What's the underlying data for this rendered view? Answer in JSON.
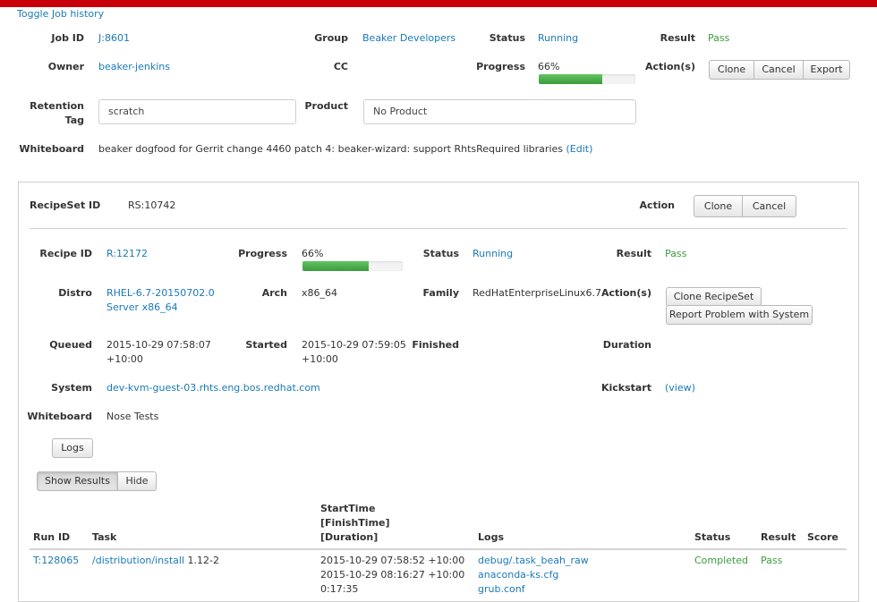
{
  "colors": {
    "top_bar": "#c8000a",
    "link": "#1a7ab8",
    "pass": "#3a9d3a",
    "progress": "#4cae4c"
  },
  "toggle_link": "Toggle Job history",
  "job": {
    "job_id_label": "Job ID",
    "job_id": "J:8601",
    "group_label": "Group",
    "group": "Beaker Developers",
    "status_label": "Status",
    "status": "Running",
    "result_label": "Result",
    "result": "Pass",
    "owner_label": "Owner",
    "owner": "beaker-jenkins",
    "cc_label": "CC",
    "progress_label": "Progress",
    "progress_text": "66%",
    "progress_value": 0.66,
    "actions_label": "Action(s)",
    "actions": [
      "Clone",
      "Cancel",
      "Export"
    ],
    "retention_label_1": "Retention",
    "retention_label_2": "Tag",
    "retention_value": "scratch",
    "product_label": "Product",
    "product_value": "No Product",
    "whiteboard_label": "Whiteboard",
    "whiteboard_text": "beaker dogfood for Gerrit change 4460 patch 4: beaker-wizard: support RhtsRequired libraries",
    "whiteboard_edit": "(Edit)"
  },
  "recipeset": {
    "id_label": "RecipeSet ID",
    "id": "RS:10742",
    "action_label": "Action",
    "actions": [
      "Clone",
      "Cancel"
    ]
  },
  "recipe": {
    "id_label": "Recipe ID",
    "id": "R:12172",
    "progress_label": "Progress",
    "progress_text": "66%",
    "progress_value": 0.66,
    "status_label": "Status",
    "status": "Running",
    "result_label": "Result",
    "result": "Pass",
    "distro_label": "Distro",
    "distro_line1": "RHEL-6.7-20150702.0",
    "distro_line2": "Server x86_64",
    "arch_label": "Arch",
    "arch": "x86_64",
    "family_label": "Family",
    "family": "RedHatEnterpriseLinux6.7",
    "actions_label": "Action(s)",
    "clone_recipeset": "Clone RecipeSet",
    "report_problem": "Report Problem with System",
    "queued_label": "Queued",
    "queued_line1": "2015-10-29 07:58:07",
    "queued_line2": "+10:00",
    "started_label": "Started",
    "started_line1": "2015-10-29 07:59:05",
    "started_line2": "+10:00",
    "finished_label": "Finished",
    "duration_label": "Duration",
    "system_label": "System",
    "system": "dev-kvm-guest-03.rhts.eng.bos.redhat.com",
    "kickstart_label": "Kickstart",
    "kickstart": "(view)",
    "whiteboard_label": "Whiteboard",
    "whiteboard": "Nose Tests",
    "logs_button": "Logs",
    "show_results": "Show Results",
    "hide": "Hide"
  },
  "results_table": {
    "headers": {
      "run_id": "Run ID",
      "task": "Task",
      "start_1": "StartTime",
      "start_2": "[FinishTime]",
      "start_3": "[Duration]",
      "logs": "Logs",
      "status": "Status",
      "result": "Result",
      "score": "Score"
    },
    "rows": [
      {
        "run_id": "T:128065",
        "task": "/distribution/install",
        "version": "1.12-2",
        "start": "2015-10-29 07:58:52 +10:00",
        "finish": "2015-10-29 08:16:27 +10:00",
        "duration": "0:17:35",
        "logs": [
          "debug/.task_beah_raw",
          "anaconda-ks.cfg",
          "grub.conf"
        ],
        "status": "Completed",
        "result": "Pass",
        "score": ""
      }
    ]
  }
}
